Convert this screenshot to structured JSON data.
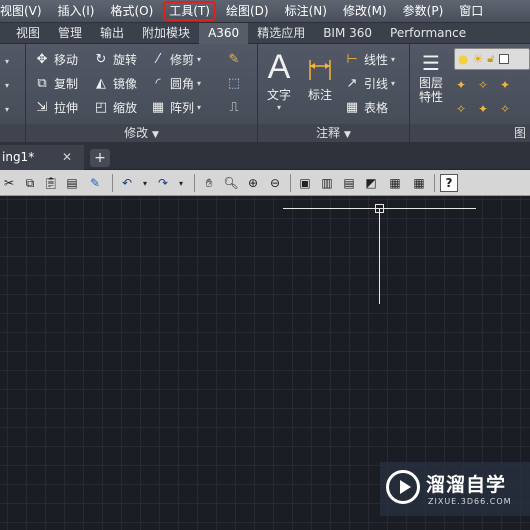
{
  "menubar": {
    "items": [
      "视图(V)",
      "插入(I)",
      "格式(O)",
      "工具(T)",
      "绘图(D)",
      "标注(N)",
      "修改(M)",
      "参数(P)",
      "窗口"
    ]
  },
  "ribbon_tabs": [
    "视图",
    "管理",
    "输出",
    "附加模块",
    "A360",
    "精选应用",
    "BIM 360",
    "Performance"
  ],
  "modify_panel": {
    "move": "移动",
    "rotate": "旋转",
    "trim": "修剪",
    "copy": "复制",
    "mirror": "镜像",
    "fillet": "圆角",
    "stretch": "拉伸",
    "scale": "缩放",
    "array": "阵列",
    "footer": "修改"
  },
  "annotation_panel": {
    "text": "文字",
    "dimension": "标注",
    "linear": "线性",
    "leader": "引线",
    "table": "表格",
    "footer": "注释"
  },
  "layers_panel": {
    "properties_line1": "图层",
    "properties_line2": "特性",
    "footer": "图"
  },
  "document": {
    "tab_label": "ing1*",
    "close": "✕",
    "new_tab": "+"
  },
  "watermark": {
    "title": "溜溜自学",
    "url": "ZIXUE.3D66.COM"
  },
  "colors": {
    "highlight_border": "#e02020",
    "canvas_bg": "#1a1d24",
    "crosshair": "#e6e6e6"
  }
}
